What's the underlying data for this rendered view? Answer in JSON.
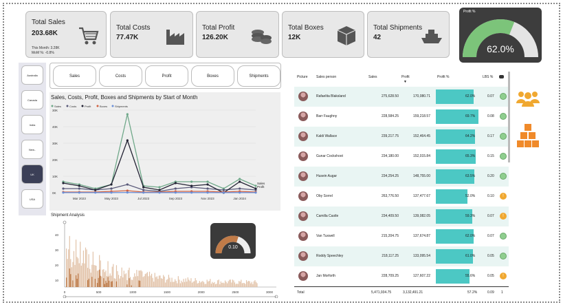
{
  "kpis": {
    "sales": {
      "title": "Total Sales",
      "value": "203.68K",
      "sub1": "This Month: 3.28K",
      "sub2": "MoM %: -0.8%"
    },
    "costs": {
      "title": "Total Costs",
      "value": "77.47K"
    },
    "profit": {
      "title": "Total Profit",
      "value": "126.20K"
    },
    "boxes": {
      "title": "Total Boxes",
      "value": "12K"
    },
    "shipments": {
      "title": "Total Shipments",
      "value": "42"
    }
  },
  "profit_gauge": {
    "label": "Profit %",
    "value_text": "62.0%",
    "fraction": 0.62
  },
  "nav": {
    "items": [
      "Australia",
      "Canada",
      "India",
      "New..",
      "UK",
      "USA"
    ],
    "active": "UK"
  },
  "tabs": [
    "Sales",
    "Costs",
    "Profit",
    "Boxes",
    "Shipments"
  ],
  "line_chart": {
    "title": "Sales, Costs, Profit, Boxes and Shipments by Start of Month",
    "legend": [
      "Sales",
      "Costs",
      "Profit",
      "Boxes",
      "Shipments"
    ],
    "end_labels": [
      "Sales",
      "Profit"
    ],
    "x_ticks": [
      "Mar 2023",
      "May 2023",
      "Jul 2023",
      "Sep 2023",
      "Nov 2023",
      "Jan 2024"
    ],
    "y_ticks": [
      "30K",
      "40K",
      "30K",
      "20K",
      "10K",
      "0K"
    ]
  },
  "chart_data": {
    "type": "line",
    "x": [
      "Feb 2023",
      "Mar 2023",
      "Apr 2023",
      "May 2023",
      "Jun 2023",
      "Jul 2023",
      "Aug 2023",
      "Sep 2023",
      "Oct 2023",
      "Nov 2023",
      "Dec 2023",
      "Jan 2024",
      "Feb 2024"
    ],
    "series": [
      {
        "name": "Sales",
        "color": "#6fa889",
        "values": [
          8,
          6,
          3,
          6,
          57,
          5,
          4,
          8,
          8,
          8,
          3,
          10,
          5
        ]
      },
      {
        "name": "Costs",
        "color": "#5a5a7a",
        "values": [
          3,
          3,
          2,
          3,
          6,
          2,
          1,
          3,
          4,
          3,
          2,
          3,
          2
        ]
      },
      {
        "name": "Profit",
        "color": "#222233",
        "values": [
          7,
          5,
          2,
          6,
          38,
          4,
          2,
          7,
          5,
          6,
          0,
          8,
          3
        ]
      },
      {
        "name": "Boxes",
        "color": "#d06040",
        "values": [
          0.5,
          0.5,
          0.5,
          1,
          1.5,
          0.5,
          0.5,
          1,
          1,
          1,
          0.5,
          1,
          0.5
        ]
      },
      {
        "name": "Shipments",
        "color": "#6a8fd8",
        "values": [
          0.1,
          0.1,
          0.1,
          0.1,
          0.2,
          0.1,
          0.1,
          0.1,
          0.1,
          0.1,
          0.1,
          0.1,
          0.1
        ]
      }
    ]
  },
  "histogram": {
    "title": "Shipment Analysis",
    "x_ticks": [
      "0",
      "500",
      "1000",
      "1500",
      "2000",
      "2500",
      "3000"
    ],
    "y_ticks": [
      "40",
      "30",
      "20",
      "10"
    ],
    "gauge_value": "0.10",
    "gauge_fraction": 0.6
  },
  "table": {
    "headers": [
      "Picture",
      "Sales person",
      "Sales",
      "Profit",
      "Profit %",
      "LBS %",
      ""
    ],
    "rows": [
      {
        "name": "Rafaelita Blaksland",
        "sales": "275,628.50",
        "profit": "170,080.71",
        "pct": "62.0%",
        "pct_val": 0.62,
        "lbs": "0.07",
        "status": "green"
      },
      {
        "name": "Barr Faughny",
        "sales": "228,584.25",
        "profit": "159,218.57",
        "pct": "69.7%",
        "pct_val": 0.697,
        "lbs": "0.08",
        "status": "green"
      },
      {
        "name": "Kaldi Wallace",
        "sales": "239,217.75",
        "profit": "152,464.45",
        "pct": "64.2%",
        "pct_val": 0.642,
        "lbs": "0.17",
        "status": "green"
      },
      {
        "name": "Gunar Cockshoot",
        "sales": "234,180.00",
        "profit": "152,015.84",
        "pct": "65.3%",
        "pct_val": 0.653,
        "lbs": "0.15",
        "status": "green"
      },
      {
        "name": "Husein Augar",
        "sales": "234,254.25",
        "profit": "148,755.00",
        "pct": "63.5%",
        "pct_val": 0.635,
        "lbs": "0.20",
        "status": "green"
      },
      {
        "name": "Oby Sorrel",
        "sales": "263,776.50",
        "profit": "137,477.67",
        "pct": "52.0%",
        "pct_val": 0.52,
        "lbs": "0.10",
        "status": "warn"
      },
      {
        "name": "Camilla Castle",
        "sales": "234,409.50",
        "profit": "139,082.05",
        "pct": "59.3%",
        "pct_val": 0.593,
        "lbs": "0.07",
        "status": "warn"
      },
      {
        "name": "Van Tuxwell",
        "sales": "215,204.75",
        "profit": "137,674.87",
        "pct": "62.0%",
        "pct_val": 0.62,
        "lbs": "0.07",
        "status": "green"
      },
      {
        "name": "Roddy Speechley",
        "sales": "218,117.25",
        "profit": "133,095.54",
        "pct": "61.0%",
        "pct_val": 0.61,
        "lbs": "0.05",
        "status": "green"
      },
      {
        "name": "Jan Morforth",
        "sales": "228,709.25",
        "profit": "127,607.22",
        "pct": "55.6%",
        "pct_val": 0.556,
        "lbs": "0.05",
        "status": "warn"
      }
    ],
    "total": {
      "label": "Total",
      "sales": "5,471,934.75",
      "profit": "3,132,491.21",
      "pct": "57.2%",
      "lbs": "0.09",
      "count": "1"
    }
  },
  "colors": {
    "teal": "#4cc8c4",
    "green_dot": "#8fce8f",
    "warn": "#f0a830",
    "orange_icon": "#f08a2a",
    "gauge_green": "#7cc47a"
  }
}
